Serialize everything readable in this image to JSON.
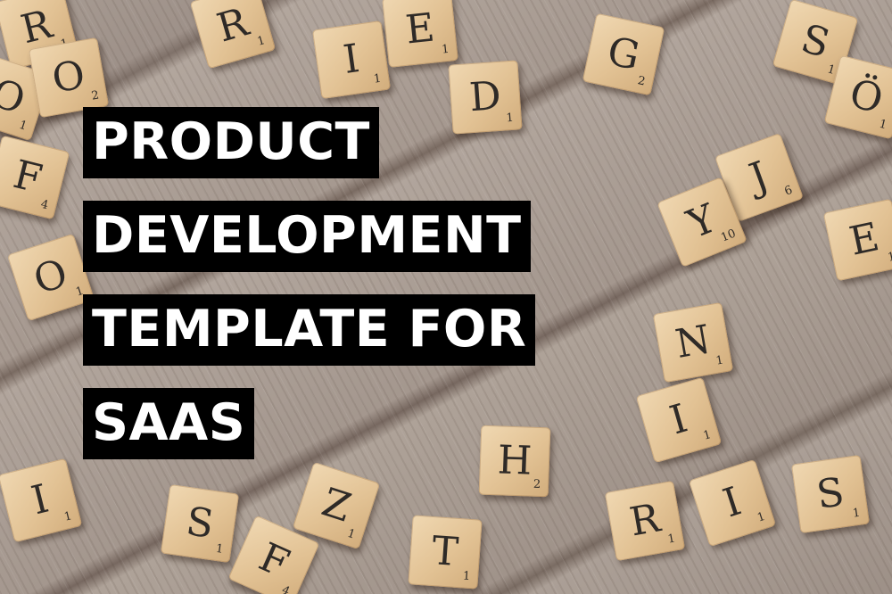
{
  "title_lines": [
    "PRODUCT",
    "DEVELOPMENT",
    "TEMPLATE FOR",
    "SAAS"
  ],
  "colors": {
    "title_bg": "#000000",
    "title_text": "#ffffff",
    "tile": "#e2c294",
    "wood": "#a69990"
  },
  "tiles": [
    {
      "letter": "R",
      "points": "1"
    },
    {
      "letter": "O",
      "points": "1"
    },
    {
      "letter": "O",
      "points": "2"
    },
    {
      "letter": "R",
      "points": "1"
    },
    {
      "letter": "I",
      "points": "1"
    },
    {
      "letter": "E",
      "points": "1"
    },
    {
      "letter": "D",
      "points": "1"
    },
    {
      "letter": "G",
      "points": "2"
    },
    {
      "letter": "S",
      "points": "1"
    },
    {
      "letter": "Ö",
      "points": "1"
    },
    {
      "letter": "F",
      "points": "4"
    },
    {
      "letter": "J",
      "points": "6"
    },
    {
      "letter": "Y",
      "points": "10"
    },
    {
      "letter": "E",
      "points": "1"
    },
    {
      "letter": "O",
      "points": "1"
    },
    {
      "letter": "N",
      "points": "1"
    },
    {
      "letter": "I",
      "points": "1"
    },
    {
      "letter": "H",
      "points": "2"
    },
    {
      "letter": "I",
      "points": "1"
    },
    {
      "letter": "S",
      "points": "1"
    },
    {
      "letter": "Z",
      "points": "1"
    },
    {
      "letter": "T",
      "points": "1"
    },
    {
      "letter": "R",
      "points": "1"
    },
    {
      "letter": "I",
      "points": "1"
    },
    {
      "letter": "S",
      "points": "1"
    },
    {
      "letter": "F",
      "points": "4"
    }
  ]
}
